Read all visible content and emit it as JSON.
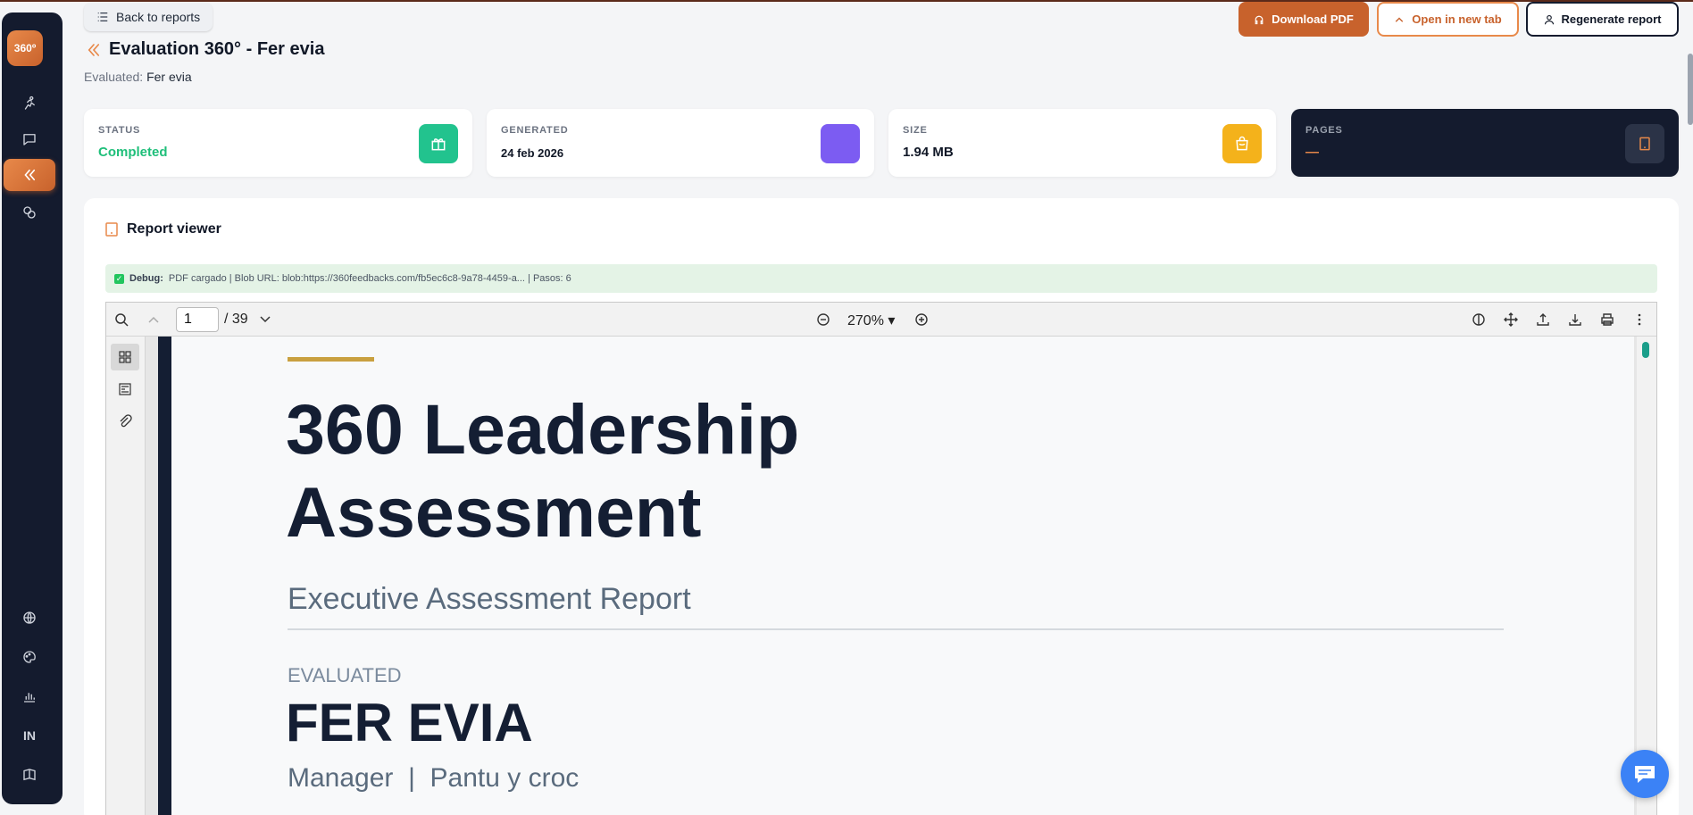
{
  "brand": {
    "logo_text": "360º",
    "accent": "#c8622c"
  },
  "sidebar": {
    "items": [
      {
        "icon": "run-icon"
      },
      {
        "icon": "chat-icon"
      },
      {
        "icon": "double-chevron-left-icon",
        "active": true
      },
      {
        "icon": "coins-icon"
      },
      {
        "icon": "globe-icon"
      },
      {
        "icon": "palette-icon"
      },
      {
        "icon": "bar-chart-icon"
      },
      {
        "icon": "linkedin-icon",
        "label": "IN"
      },
      {
        "icon": "book-icon"
      }
    ]
  },
  "header": {
    "back_label": "Back to reports",
    "title": "Evaluation 360° - Fer evia",
    "evaluated_prefix": "Evaluated:",
    "evaluated_name": "Fer evia",
    "download_label": "Download PDF",
    "open_label": "Open in new tab",
    "regenerate_label": "Regenerate report"
  },
  "stats": [
    {
      "label": "STATUS",
      "value": "Completed",
      "color": "#1fbf7a",
      "icon": "gift-icon",
      "icon_bg": "#22c38e"
    },
    {
      "label": "GENERATED",
      "value": "24 feb 2026",
      "color": "#111827",
      "icon": "blank-icon",
      "icon_bg": "#7c5cf2"
    },
    {
      "label": "SIZE",
      "value": "1.94 MB",
      "color": "#111827",
      "icon": "bag-icon",
      "icon_bg": "#f4b21b"
    },
    {
      "label": "PAGES",
      "value": "—",
      "color": "#e8894a",
      "icon": "document-icon",
      "icon_bg": "#2b3347"
    }
  ],
  "viewer": {
    "title": "Report viewer",
    "debug_label": "Debug:",
    "debug_text": "PDF cargado | Blob URL: blob:https://360feedbacks.com/fb5ec6c8-9a78-4459-a... | Pasos: 6",
    "page_current": "1",
    "page_total": "/ 39",
    "zoom": "270%"
  },
  "document": {
    "title_line1": "360 Leadership",
    "title_line2": "Assessment",
    "subtitle": "Executive Assessment Report",
    "evaluated_label": "EVALUATED",
    "name": "FER EVIA",
    "role": "Manager  |  Pantu y croc"
  }
}
